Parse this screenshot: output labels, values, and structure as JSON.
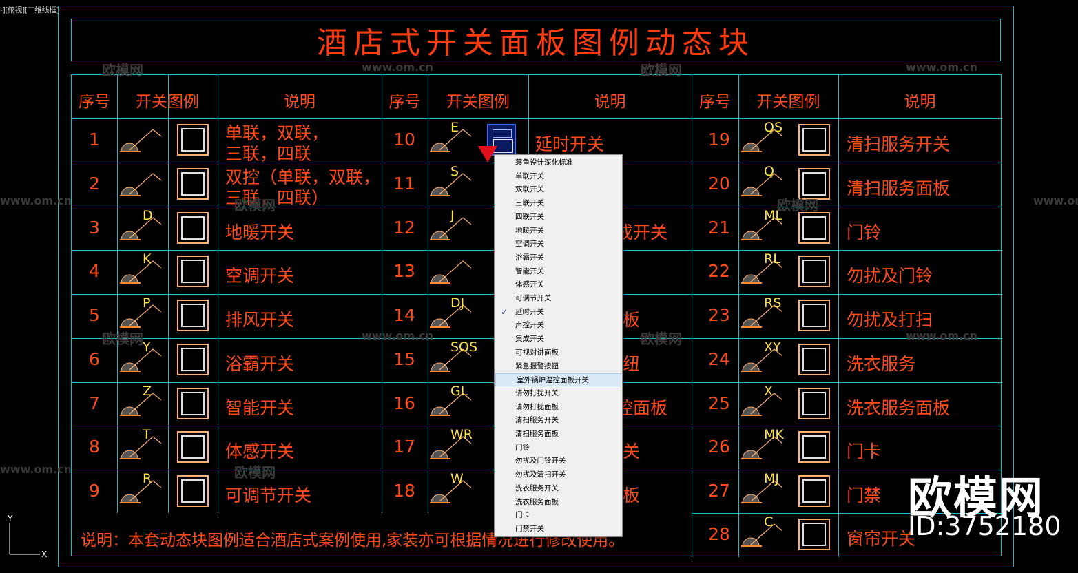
{
  "viewport_label": "-][俯视][二维线框]",
  "title": "酒店式开关面板图例动态块",
  "headers": {
    "seq": "序号",
    "legend": "开关图例",
    "desc": "说明"
  },
  "col1": [
    {
      "n": "1",
      "code": "",
      "desc1": "单联，双联，",
      "desc2": "三联，四联"
    },
    {
      "n": "2",
      "code": "",
      "desc1": "双控（单联，双联，",
      "desc2": "三联，四联）"
    },
    {
      "n": "3",
      "code": "D",
      "desc1": "地暖开关",
      "desc2": ""
    },
    {
      "n": "4",
      "code": "K",
      "desc1": "空调开关",
      "desc2": ""
    },
    {
      "n": "5",
      "code": "P",
      "desc1": "排风开关",
      "desc2": ""
    },
    {
      "n": "6",
      "code": "Y",
      "desc1": "浴霸开关",
      "desc2": ""
    },
    {
      "n": "7",
      "code": "Z",
      "desc1": "智能开关",
      "desc2": ""
    },
    {
      "n": "8",
      "code": "T",
      "desc1": "体感开关",
      "desc2": ""
    },
    {
      "n": "9",
      "code": "R",
      "desc1": "可调节开关",
      "desc2": ""
    }
  ],
  "col2": [
    {
      "n": "10",
      "code": "E",
      "desc": "延时开关"
    },
    {
      "n": "11",
      "code": "S",
      "desc": ""
    },
    {
      "n": "12",
      "code": "J",
      "desc": "成开关"
    },
    {
      "n": "13",
      "code": "",
      "desc": ""
    },
    {
      "n": "14",
      "code": "DJ",
      "desc": "板"
    },
    {
      "n": "15",
      "code": "SOS",
      "desc": "纽"
    },
    {
      "n": "16",
      "code": "GL",
      "desc": "控面板"
    },
    {
      "n": "17",
      "code": "WR",
      "desc": "关"
    },
    {
      "n": "18",
      "code": "W",
      "desc": "板"
    }
  ],
  "col3": [
    {
      "n": "19",
      "code": "QS",
      "desc": "清扫服务开关"
    },
    {
      "n": "20",
      "code": "Q",
      "desc": "清扫服务面板"
    },
    {
      "n": "21",
      "code": "ML",
      "desc": "门铃"
    },
    {
      "n": "22",
      "code": "RL",
      "desc": "勿扰及门铃"
    },
    {
      "n": "23",
      "code": "RS",
      "desc": "勿扰及打扫"
    },
    {
      "n": "24",
      "code": "XY",
      "desc": "洗衣服务"
    },
    {
      "n": "25",
      "code": "X",
      "desc": "洗衣服务面板"
    },
    {
      "n": "26",
      "code": "MK",
      "desc": "门卡"
    },
    {
      "n": "27",
      "code": "MJ",
      "desc": "门禁"
    },
    {
      "n": "28",
      "code": "C",
      "desc": "窗帘开关"
    }
  ],
  "note": "说明：本套动态块图例适合酒店式案例使用,家装亦可根据情况进行修改使用。",
  "watermark": "www.om.cn",
  "watermark_cn": "欧模网",
  "brand": "欧模网",
  "brand_id": "ID:3752180",
  "ucs": {
    "y": "Y",
    "x": "X"
  },
  "menu": {
    "checked_index": 11,
    "hover_index": 16,
    "items": [
      "蓑鱼设计深化标准",
      "单联开关",
      "双联开关",
      "三联开关",
      "四联开关",
      "地暖开关",
      "空调开关",
      "浴霸开关",
      "智能开关",
      "体感开关",
      "可调节开关",
      "延时开关",
      "声控开关",
      "集成开关",
      "可视对讲面板",
      "紧急报警按钮",
      "室外锅炉温控面板开关",
      "请勿打扰开关",
      "请勿打扰面板",
      "清扫服务开关",
      "清扫服务面板",
      "门铃",
      "勿扰及门铃开关",
      "勿扰及清扫开关",
      "洗衣服务开关",
      "洗衣服务面板",
      "门卡",
      "门禁开关"
    ]
  },
  "colors": {
    "cyan": "#1fb9c9",
    "red": "#ff4a1a",
    "yellow": "#ffe24a"
  }
}
